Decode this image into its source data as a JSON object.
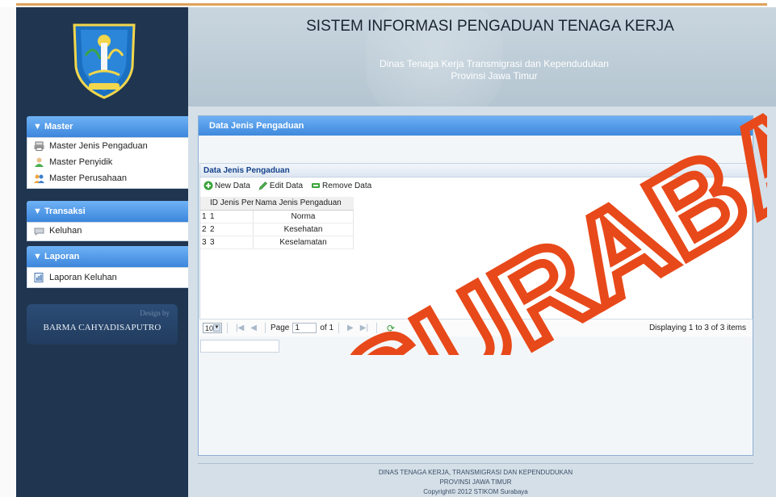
{
  "header": {
    "title": "SISTEM INFORMASI PENGADUAN TENAGA KERJA",
    "subtitle_line1": "Dinas Tenaga Kerja Transmigrasi dan Kependudukan",
    "subtitle_line2": "Provinsi Jawa Timur"
  },
  "sidebar": {
    "master": {
      "label": "▼ Master",
      "items": [
        {
          "label": "Master Jenis Pengaduan",
          "icon": "printer-icon"
        },
        {
          "label": "Master Penyidik",
          "icon": "user-icon"
        },
        {
          "label": "Master Perusahaan",
          "icon": "users-icon"
        }
      ]
    },
    "transaksi": {
      "label": "▼ Transaksi",
      "items": [
        {
          "label": "Keluhan",
          "icon": "complaint-icon"
        }
      ]
    },
    "laporan": {
      "label": "▼ Laporan",
      "items": [
        {
          "label": "Laporan Keluhan",
          "icon": "report-icon"
        }
      ]
    },
    "design_by": "Design by",
    "designer": "BARMA CAHYADISAPUTRO"
  },
  "panel": {
    "title": "Data Jenis Pengaduan",
    "grid": {
      "title": "Data Jenis Pengaduan",
      "toolbar": {
        "new": "New Data",
        "edit": "Edit Data",
        "remove": "Remove Data"
      },
      "columns": [
        "ID Jenis Pengaduan",
        "Nama Jenis Pengaduan"
      ],
      "rows": [
        {
          "rn": "1",
          "id": "1",
          "name": "Norma"
        },
        {
          "rn": "2",
          "id": "2",
          "name": "Kesehatan"
        },
        {
          "rn": "3",
          "id": "3",
          "name": "Keselamatan"
        }
      ]
    },
    "pager": {
      "page_size": "10",
      "page_label": "Page",
      "page_value": "1",
      "of_label": "of 1",
      "display": "Displaying 1 to 3 of 3 items"
    }
  },
  "footer": {
    "line1": "DINAS TENAGA KERJA, TRANSMIGRASI DAN KEPENDUDUKAN",
    "line2": "PROVINSI JAWA TIMUR",
    "line3": "Copyright© 2012 STIKOM Surabaya"
  },
  "watermark": "SURABAYA",
  "colors": {
    "sidebar_bg": "#1f3550",
    "header_blue": "#3f89dc",
    "banner_bg": "#c0cfda",
    "watermark": "#e8491a"
  }
}
